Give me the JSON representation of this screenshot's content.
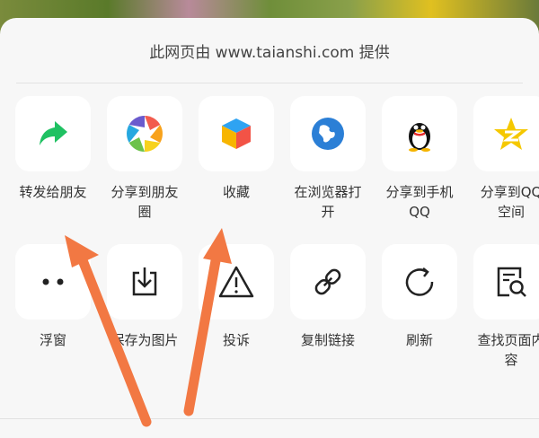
{
  "header": {
    "title": "此网页由 www.taianshi.com 提供"
  },
  "share_row": [
    {
      "label": "转发给朋友",
      "icon": "forward-arrow-icon"
    },
    {
      "label": "分享到朋友\n圈",
      "icon": "moments-aperture-icon"
    },
    {
      "label": "收藏",
      "icon": "favorites-cube-icon"
    },
    {
      "label": "在浏览器打\n开",
      "icon": "globe-browser-icon"
    },
    {
      "label": "分享到手机\nQQ",
      "icon": "qq-penguin-icon"
    },
    {
      "label": "分享到QQ\n空间",
      "icon": "qzone-star-icon"
    }
  ],
  "action_row": [
    {
      "label": "浮窗",
      "icon": "float-window-dots-icon"
    },
    {
      "label": "保存为图片",
      "icon": "save-image-download-icon"
    },
    {
      "label": "投诉",
      "icon": "warning-triangle-icon"
    },
    {
      "label": "复制链接",
      "icon": "link-chain-icon"
    },
    {
      "label": "刷新",
      "icon": "refresh-icon"
    },
    {
      "label": "查找页面内\n容",
      "icon": "search-document-icon"
    }
  ],
  "colors": {
    "accent_arrow": "#f27843",
    "forward_green": "#1fc162",
    "globe_blue": "#2b7fd6",
    "qzone_yellow": "#f5c800"
  }
}
